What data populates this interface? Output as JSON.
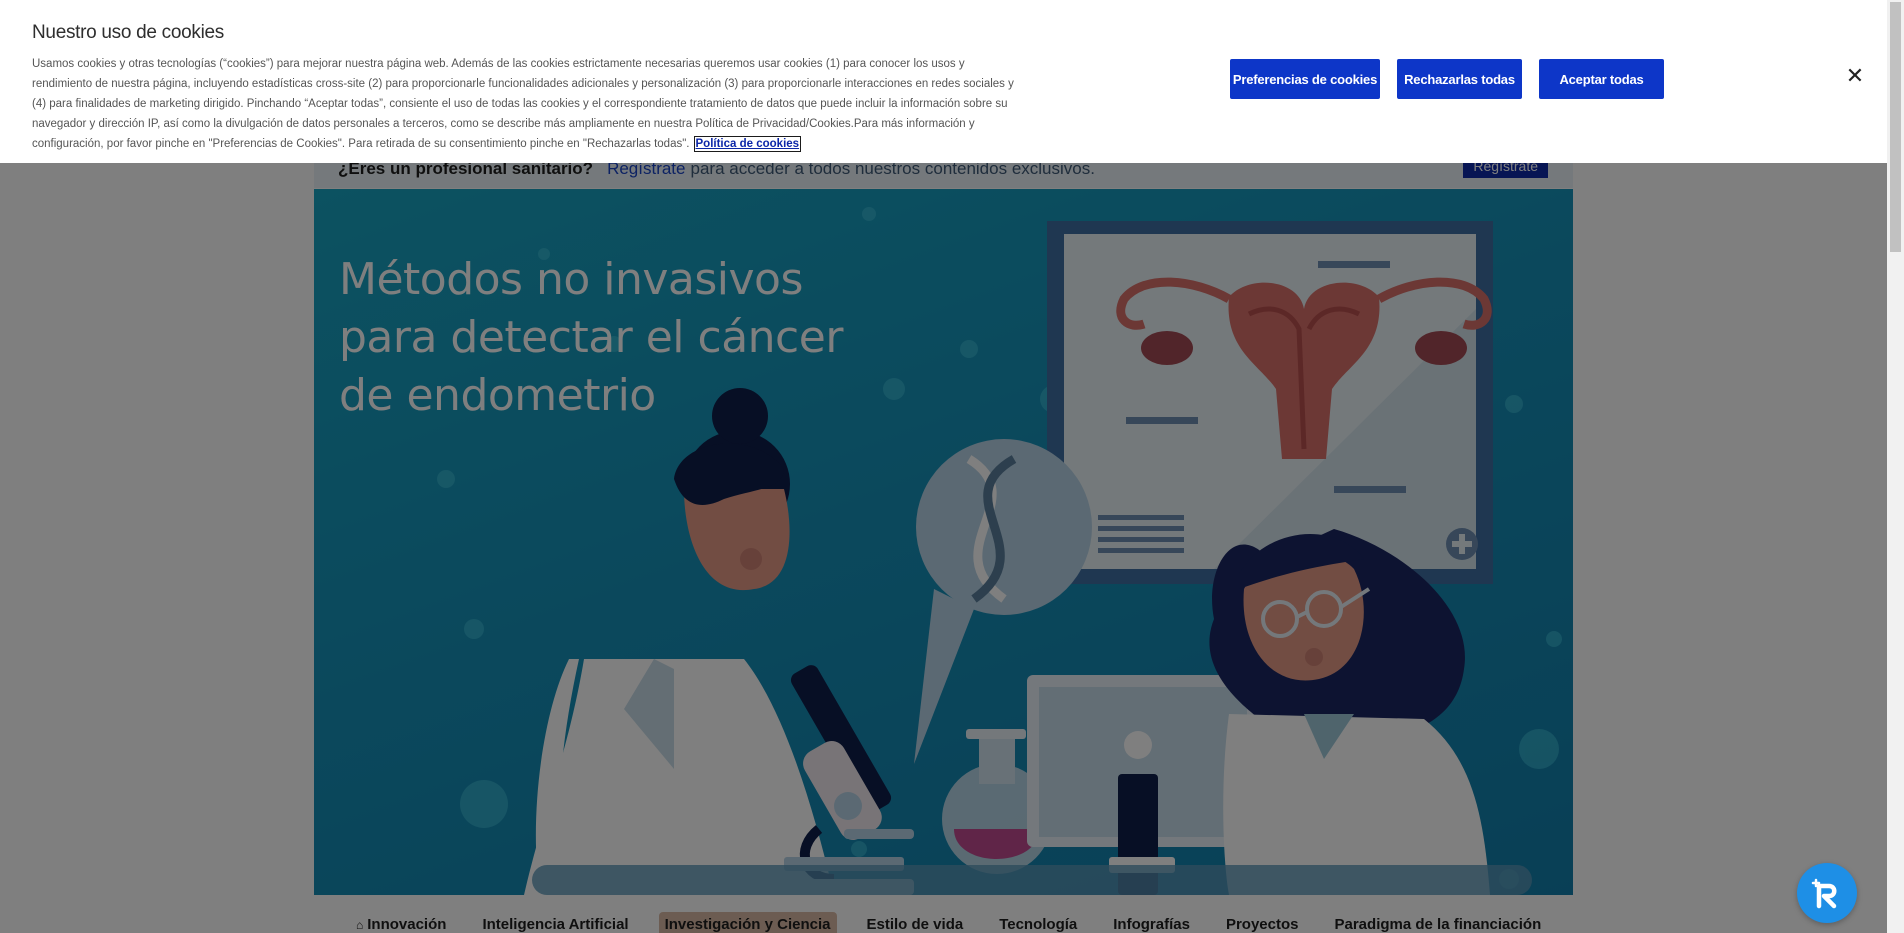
{
  "cookie_banner": {
    "title": "Nuestro uso de cookies",
    "body": "Usamos cookies y otras tecnologías (“cookies”) para mejorar nuestra página web. Además de las cookies estrictamente necesarias queremos usar cookies (1) para conocer los usos y rendimiento de nuestra página, incluyendo estadísticas cross-site (2) para proporcionarle funcionalidades adicionales y personalización (3) para proporcionarle interacciones en redes sociales y (4) para finalidades de marketing dirigido. Pinchando “Aceptar todas”, consiente el uso de todas las cookies y el correspondiente tratamiento de datos que puede incluir la información sobre su navegador y dirección IP, así como la divulgación de datos personales a terceros, como se describe más ampliamente en nuestra Política de Privacidad/Cookies.Para más información y configuración, por favor pinche en \"Preferencias de Cookies\". Para retirada de su consentimiento pinche en \"Rechazarlas todas\".",
    "policy_link": "Política de cookies",
    "buttons": {
      "preferences": "Preferencias de cookies",
      "reject_all": "Rechazarlas todas",
      "accept_all": "Aceptar todas"
    },
    "close_icon": "close-icon"
  },
  "pro_bar": {
    "title": "¿Eres un profesional sanitario?",
    "link": "Regístrate",
    "text": "para acceder a todos nuestros contenidos exclusivos.",
    "button": "Regístrate"
  },
  "hero": {
    "title": "Métodos no invasivos para detectar el cáncer de endometrio"
  },
  "nav": {
    "items": [
      {
        "label": "Innovación",
        "icon": "home-icon"
      },
      {
        "label": "Inteligencia Artificial"
      },
      {
        "label": "Investigación y Ciencia",
        "active": true
      },
      {
        "label": "Estilo de vida"
      },
      {
        "label": "Tecnología"
      },
      {
        "label": "Infografías"
      },
      {
        "label": "Proyectos"
      },
      {
        "label": "Paradigma de la financiación"
      }
    ]
  },
  "widget": {
    "icon": "accessibility-assistant-icon"
  },
  "colors": {
    "primary_button": "#0d36c8",
    "hero_background": "#1691b9",
    "overlay": "rgba(0,0,0,0.5)"
  }
}
